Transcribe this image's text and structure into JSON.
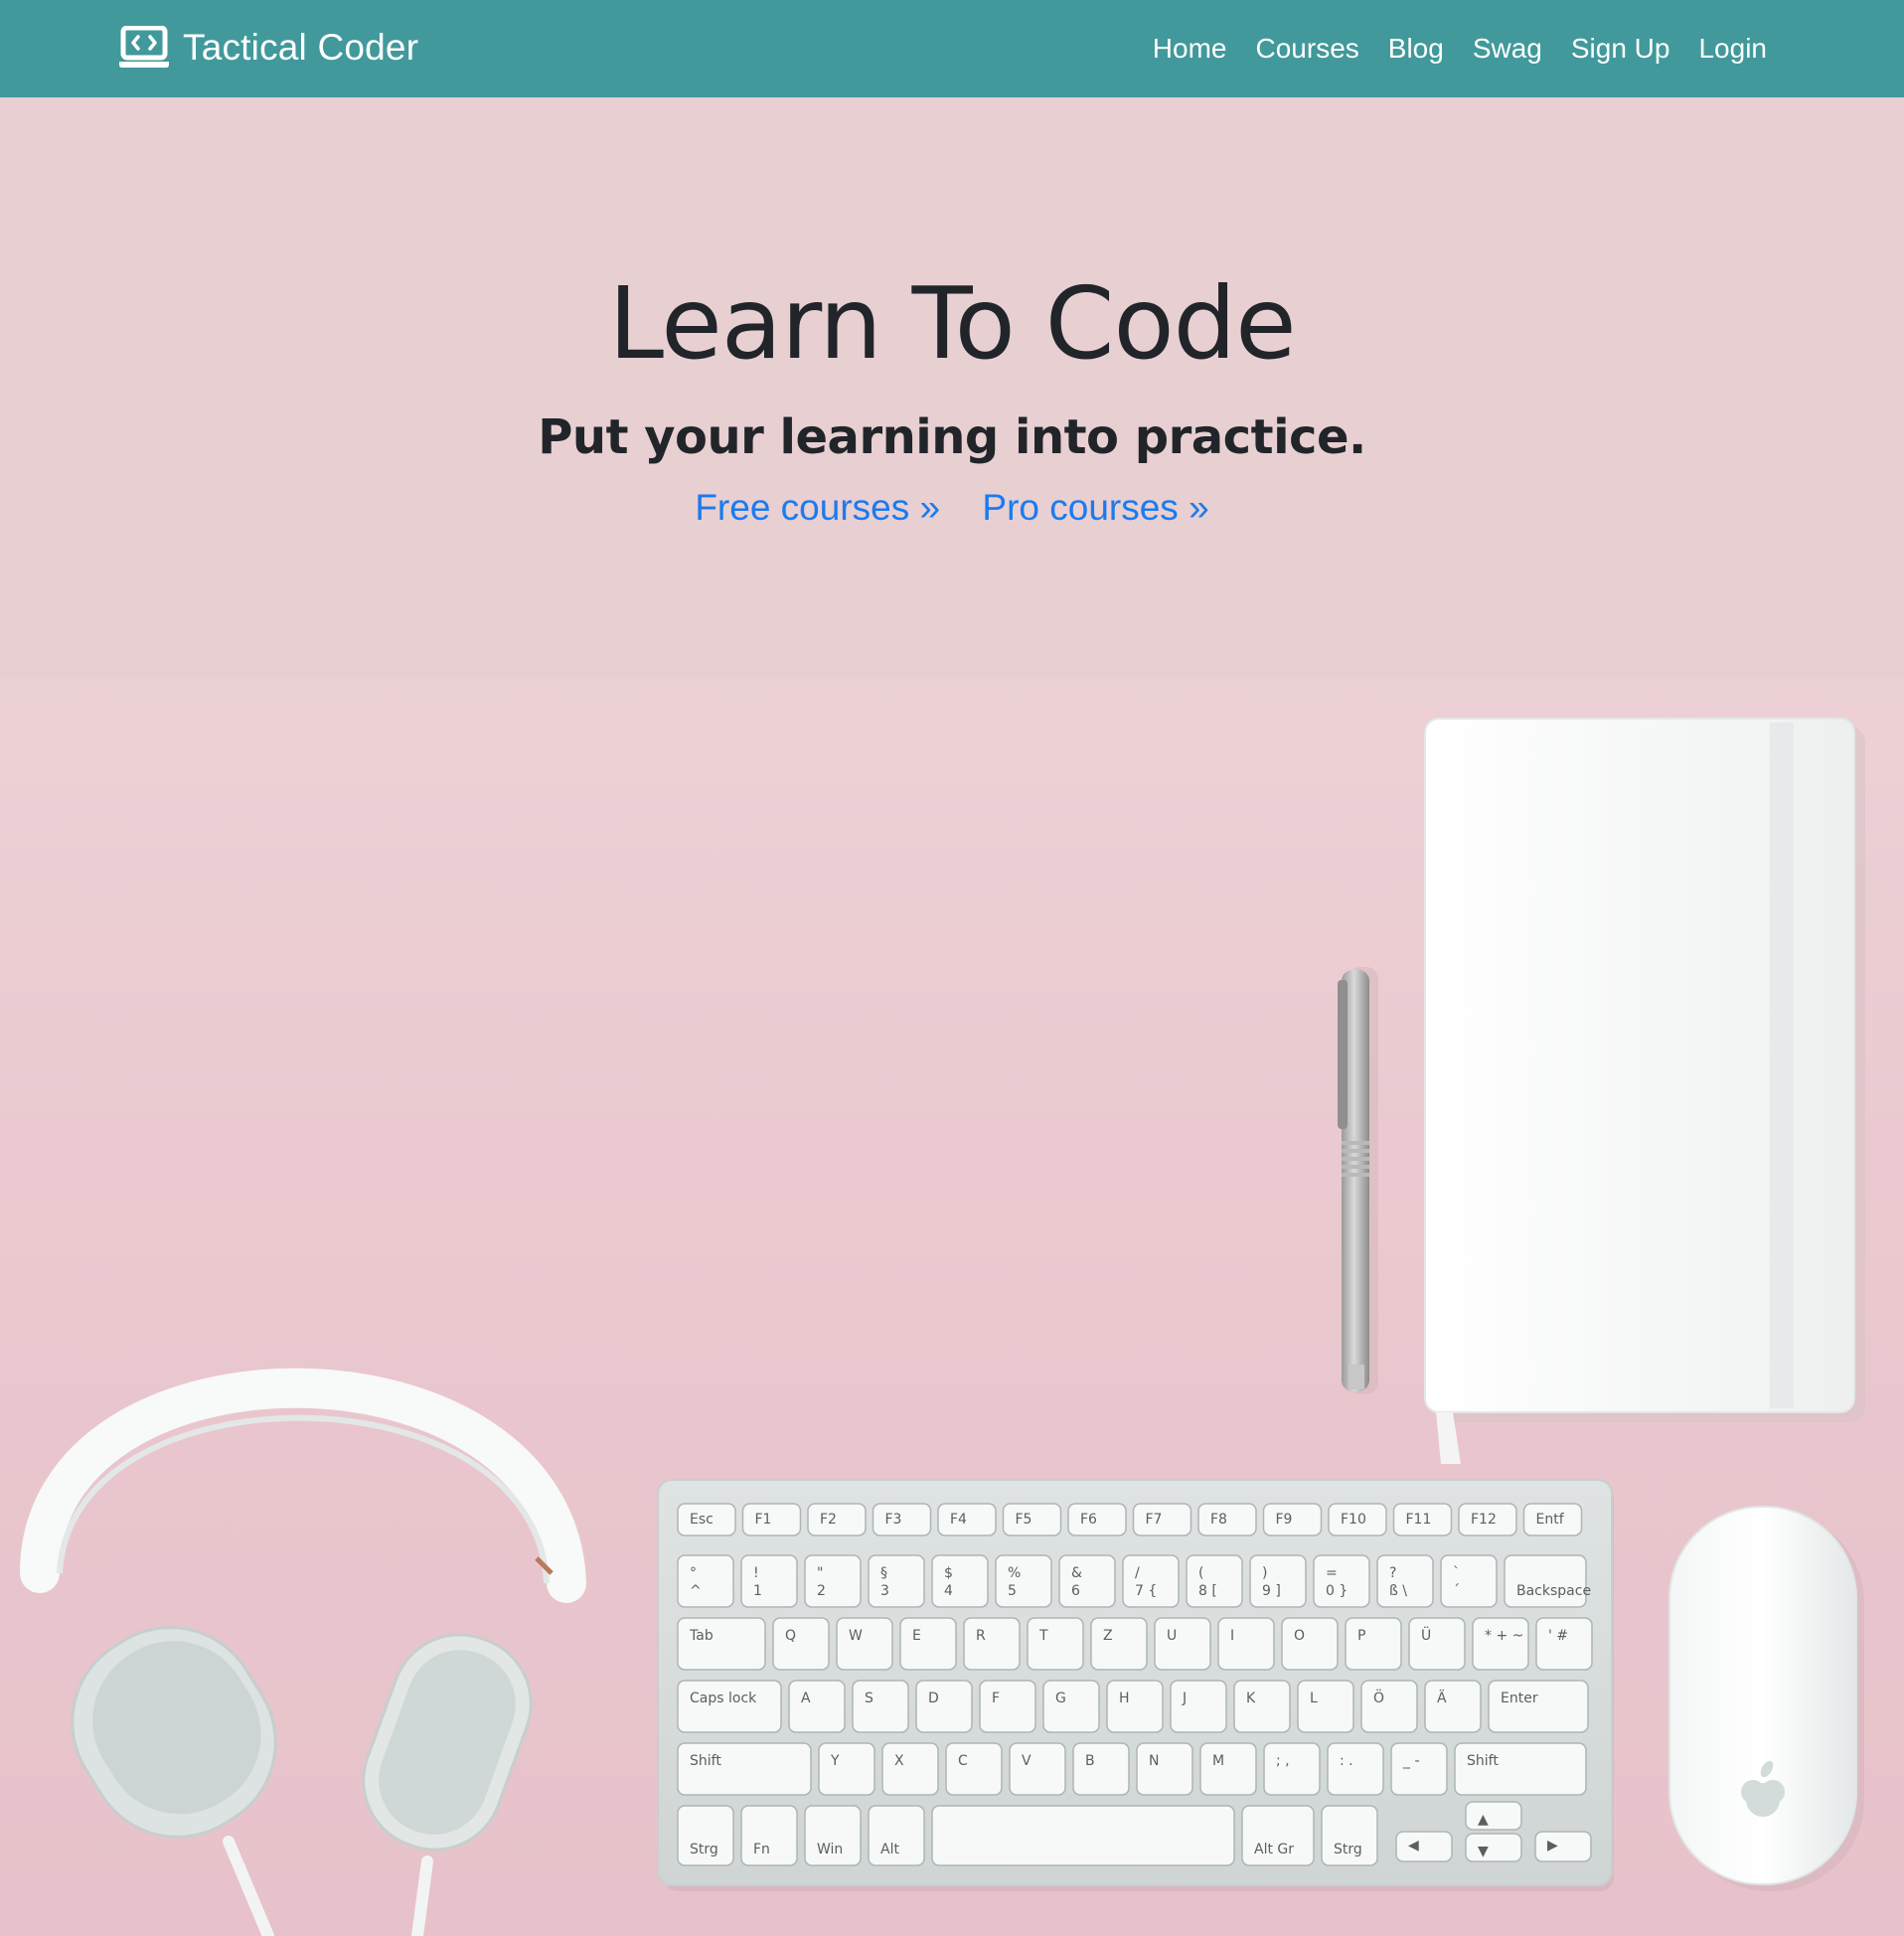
{
  "navbar": {
    "brand": "Tactical Coder",
    "links": [
      {
        "label": "Home"
      },
      {
        "label": "Courses"
      },
      {
        "label": "Blog"
      },
      {
        "label": "Swag"
      },
      {
        "label": "Sign Up"
      },
      {
        "label": "Login"
      }
    ]
  },
  "hero": {
    "title": "Learn To Code",
    "subtitle": "Put your learning into practice.",
    "links": [
      {
        "label": "Free courses »"
      },
      {
        "label": "Pro courses »"
      }
    ]
  },
  "colors": {
    "navbar_bg": "#41999b",
    "hero_bg": "#e8cfd2",
    "link": "#1a7bf0",
    "text": "#212529"
  },
  "photo": {
    "function_keys": [
      {
        "sub": "Esc"
      },
      {
        "sub": "F1"
      },
      {
        "sub": "F2"
      },
      {
        "sub": "F3"
      },
      {
        "sub": "F4"
      },
      {
        "sub": "F5"
      },
      {
        "sub": "F6"
      },
      {
        "sub": "F7"
      },
      {
        "sub": "F8"
      },
      {
        "sub": "F9"
      },
      {
        "sub": "F10"
      },
      {
        "sub": "F11"
      },
      {
        "sub": "F12"
      },
      {
        "sub": "Entf"
      }
    ],
    "number_row": [
      {
        "top": "°",
        "bottom": "^"
      },
      {
        "top": "!",
        "bottom": "1"
      },
      {
        "top": "\"",
        "bottom": "2"
      },
      {
        "top": "§",
        "bottom": "3"
      },
      {
        "top": "$",
        "bottom": "4"
      },
      {
        "top": "%",
        "bottom": "5"
      },
      {
        "top": "&",
        "bottom": "6"
      },
      {
        "top": "/",
        "bottom": "7 {"
      },
      {
        "top": "(",
        "bottom": "8 ["
      },
      {
        "top": ")",
        "bottom": "9 ]"
      },
      {
        "top": "=",
        "bottom": "0 }"
      },
      {
        "top": "?",
        "bottom": "ß \\"
      },
      {
        "top": "`",
        "bottom": "´"
      },
      {
        "top": "",
        "bottom": "Backspace"
      }
    ],
    "qwerty_row": [
      {
        "label": "Tab"
      },
      {
        "label": "Q"
      },
      {
        "label": "W"
      },
      {
        "label": "E"
      },
      {
        "label": "R"
      },
      {
        "label": "T"
      },
      {
        "label": "Z"
      },
      {
        "label": "U"
      },
      {
        "label": "I"
      },
      {
        "label": "O"
      },
      {
        "label": "P"
      },
      {
        "label": "Ü"
      },
      {
        "label": "* + ~"
      },
      {
        "label": "' #"
      }
    ],
    "home_row": [
      {
        "label": "Caps lock"
      },
      {
        "label": "A"
      },
      {
        "label": "S"
      },
      {
        "label": "D"
      },
      {
        "label": "F"
      },
      {
        "label": "G"
      },
      {
        "label": "H"
      },
      {
        "label": "J"
      },
      {
        "label": "K"
      },
      {
        "label": "L"
      },
      {
        "label": "Ö"
      },
      {
        "label": "Ä"
      },
      {
        "label": "Enter"
      }
    ],
    "shift_row": [
      {
        "label": "Shift"
      },
      {
        "label": "Y"
      },
      {
        "label": "X"
      },
      {
        "label": "C"
      },
      {
        "label": "V"
      },
      {
        "label": "B"
      },
      {
        "label": "N"
      },
      {
        "label": "M"
      },
      {
        "label": "; ,"
      },
      {
        "label": ": ."
      },
      {
        "label": "_ -"
      },
      {
        "label": "Shift"
      }
    ],
    "bottom_row": [
      {
        "label": "Strg"
      },
      {
        "label": "Fn"
      },
      {
        "label": "Win"
      },
      {
        "label": "Alt"
      },
      {
        "label": ""
      },
      {
        "label": "Alt Gr"
      },
      {
        "label": "Strg"
      }
    ]
  }
}
